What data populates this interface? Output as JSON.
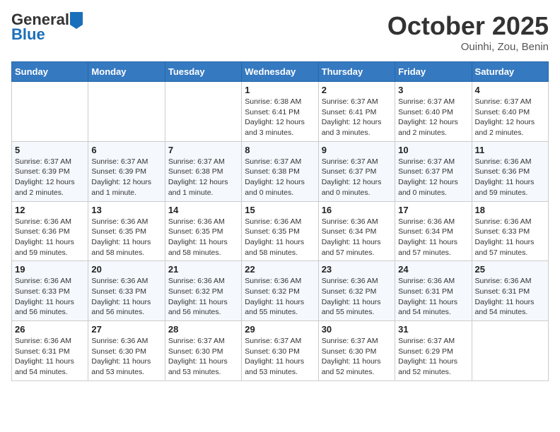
{
  "header": {
    "logo_line1": "General",
    "logo_line2": "Blue",
    "month": "October 2025",
    "location": "Ouinhi, Zou, Benin"
  },
  "weekdays": [
    "Sunday",
    "Monday",
    "Tuesday",
    "Wednesday",
    "Thursday",
    "Friday",
    "Saturday"
  ],
  "weeks": [
    [
      {
        "day": "",
        "info": ""
      },
      {
        "day": "",
        "info": ""
      },
      {
        "day": "",
        "info": ""
      },
      {
        "day": "1",
        "info": "Sunrise: 6:38 AM\nSunset: 6:41 PM\nDaylight: 12 hours\nand 3 minutes."
      },
      {
        "day": "2",
        "info": "Sunrise: 6:37 AM\nSunset: 6:41 PM\nDaylight: 12 hours\nand 3 minutes."
      },
      {
        "day": "3",
        "info": "Sunrise: 6:37 AM\nSunset: 6:40 PM\nDaylight: 12 hours\nand 2 minutes."
      },
      {
        "day": "4",
        "info": "Sunrise: 6:37 AM\nSunset: 6:40 PM\nDaylight: 12 hours\nand 2 minutes."
      }
    ],
    [
      {
        "day": "5",
        "info": "Sunrise: 6:37 AM\nSunset: 6:39 PM\nDaylight: 12 hours\nand 2 minutes."
      },
      {
        "day": "6",
        "info": "Sunrise: 6:37 AM\nSunset: 6:39 PM\nDaylight: 12 hours\nand 1 minute."
      },
      {
        "day": "7",
        "info": "Sunrise: 6:37 AM\nSunset: 6:38 PM\nDaylight: 12 hours\nand 1 minute."
      },
      {
        "day": "8",
        "info": "Sunrise: 6:37 AM\nSunset: 6:38 PM\nDaylight: 12 hours\nand 0 minutes."
      },
      {
        "day": "9",
        "info": "Sunrise: 6:37 AM\nSunset: 6:37 PM\nDaylight: 12 hours\nand 0 minutes."
      },
      {
        "day": "10",
        "info": "Sunrise: 6:37 AM\nSunset: 6:37 PM\nDaylight: 12 hours\nand 0 minutes."
      },
      {
        "day": "11",
        "info": "Sunrise: 6:36 AM\nSunset: 6:36 PM\nDaylight: 11 hours\nand 59 minutes."
      }
    ],
    [
      {
        "day": "12",
        "info": "Sunrise: 6:36 AM\nSunset: 6:36 PM\nDaylight: 11 hours\nand 59 minutes."
      },
      {
        "day": "13",
        "info": "Sunrise: 6:36 AM\nSunset: 6:35 PM\nDaylight: 11 hours\nand 58 minutes."
      },
      {
        "day": "14",
        "info": "Sunrise: 6:36 AM\nSunset: 6:35 PM\nDaylight: 11 hours\nand 58 minutes."
      },
      {
        "day": "15",
        "info": "Sunrise: 6:36 AM\nSunset: 6:35 PM\nDaylight: 11 hours\nand 58 minutes."
      },
      {
        "day": "16",
        "info": "Sunrise: 6:36 AM\nSunset: 6:34 PM\nDaylight: 11 hours\nand 57 minutes."
      },
      {
        "day": "17",
        "info": "Sunrise: 6:36 AM\nSunset: 6:34 PM\nDaylight: 11 hours\nand 57 minutes."
      },
      {
        "day": "18",
        "info": "Sunrise: 6:36 AM\nSunset: 6:33 PM\nDaylight: 11 hours\nand 57 minutes."
      }
    ],
    [
      {
        "day": "19",
        "info": "Sunrise: 6:36 AM\nSunset: 6:33 PM\nDaylight: 11 hours\nand 56 minutes."
      },
      {
        "day": "20",
        "info": "Sunrise: 6:36 AM\nSunset: 6:33 PM\nDaylight: 11 hours\nand 56 minutes."
      },
      {
        "day": "21",
        "info": "Sunrise: 6:36 AM\nSunset: 6:32 PM\nDaylight: 11 hours\nand 56 minutes."
      },
      {
        "day": "22",
        "info": "Sunrise: 6:36 AM\nSunset: 6:32 PM\nDaylight: 11 hours\nand 55 minutes."
      },
      {
        "day": "23",
        "info": "Sunrise: 6:36 AM\nSunset: 6:32 PM\nDaylight: 11 hours\nand 55 minutes."
      },
      {
        "day": "24",
        "info": "Sunrise: 6:36 AM\nSunset: 6:31 PM\nDaylight: 11 hours\nand 54 minutes."
      },
      {
        "day": "25",
        "info": "Sunrise: 6:36 AM\nSunset: 6:31 PM\nDaylight: 11 hours\nand 54 minutes."
      }
    ],
    [
      {
        "day": "26",
        "info": "Sunrise: 6:36 AM\nSunset: 6:31 PM\nDaylight: 11 hours\nand 54 minutes."
      },
      {
        "day": "27",
        "info": "Sunrise: 6:36 AM\nSunset: 6:30 PM\nDaylight: 11 hours\nand 53 minutes."
      },
      {
        "day": "28",
        "info": "Sunrise: 6:37 AM\nSunset: 6:30 PM\nDaylight: 11 hours\nand 53 minutes."
      },
      {
        "day": "29",
        "info": "Sunrise: 6:37 AM\nSunset: 6:30 PM\nDaylight: 11 hours\nand 53 minutes."
      },
      {
        "day": "30",
        "info": "Sunrise: 6:37 AM\nSunset: 6:30 PM\nDaylight: 11 hours\nand 52 minutes."
      },
      {
        "day": "31",
        "info": "Sunrise: 6:37 AM\nSunset: 6:29 PM\nDaylight: 11 hours\nand 52 minutes."
      },
      {
        "day": "",
        "info": ""
      }
    ]
  ]
}
